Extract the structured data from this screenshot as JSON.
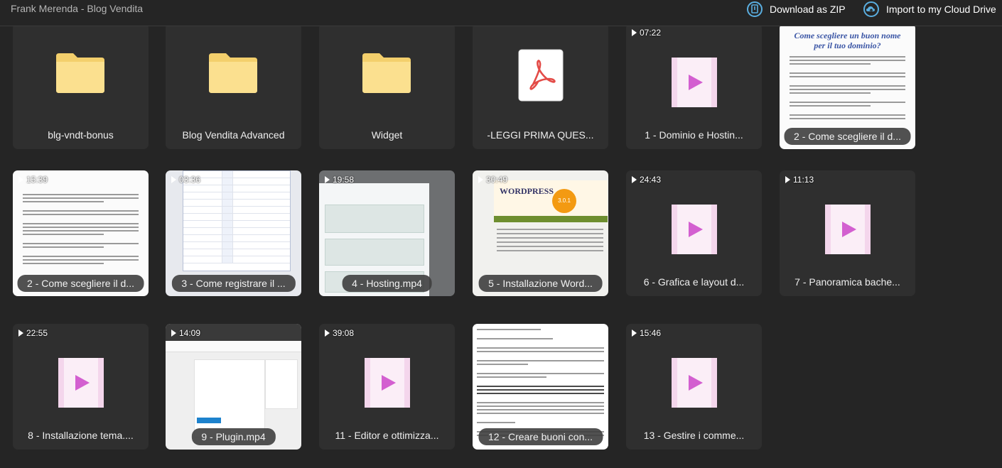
{
  "header": {
    "title": "Frank Merenda - Blog Vendita",
    "download_label": "Download as ZIP",
    "import_label": "Import to my Cloud Drive",
    "icon_color": "#5aaee0"
  },
  "tiles": [
    {
      "kind": "folder",
      "name": "blg-vndt-bonus"
    },
    {
      "kind": "folder",
      "name": "Blog Vendita Advanced"
    },
    {
      "kind": "folder",
      "name": "Widget"
    },
    {
      "kind": "pdf",
      "name": "-LEGGI PRIMA QUES..."
    },
    {
      "kind": "video",
      "name": "1 - Dominio e Hostin...",
      "duration": "07:22"
    },
    {
      "kind": "document",
      "name": "2 - Come scegliere il d...",
      "heading": "Come scegliere un buon nome per il tuo dominio?"
    },
    {
      "kind": "video-thumb",
      "name": "2 - Come scegliere il d...",
      "duration": "15:39"
    },
    {
      "kind": "video-thumb",
      "name": "3 - Come registrare il ...",
      "duration": "03:36"
    },
    {
      "kind": "video-thumb",
      "name": "4 - Hosting.mp4",
      "duration": "19:58"
    },
    {
      "kind": "video-thumb",
      "name": "5 - Installazione Word...",
      "duration": "30:49",
      "logo": "WORDPRESS",
      "badge": "3.0.1"
    },
    {
      "kind": "video",
      "name": "6 - Grafica e layout d...",
      "duration": "24:43"
    },
    {
      "kind": "video",
      "name": "7 - Panoramica bache...",
      "duration": "11:13"
    },
    {
      "kind": "video",
      "name": "8 - Installazione tema....",
      "duration": "22:55"
    },
    {
      "kind": "video-thumb",
      "name": "9 - Plugin.mp4",
      "duration": "14:09"
    },
    {
      "kind": "video",
      "name": "11 - Editor e ottimizza...",
      "duration": "39:08"
    },
    {
      "kind": "document",
      "name": "12 - Creare buoni con..."
    },
    {
      "kind": "video",
      "name": "13 - Gestire i comme...",
      "duration": "15:46"
    }
  ],
  "colors": {
    "folder": "#f6d77d",
    "video_play": "#d35fd0",
    "pdf_red": "#e34b47"
  }
}
